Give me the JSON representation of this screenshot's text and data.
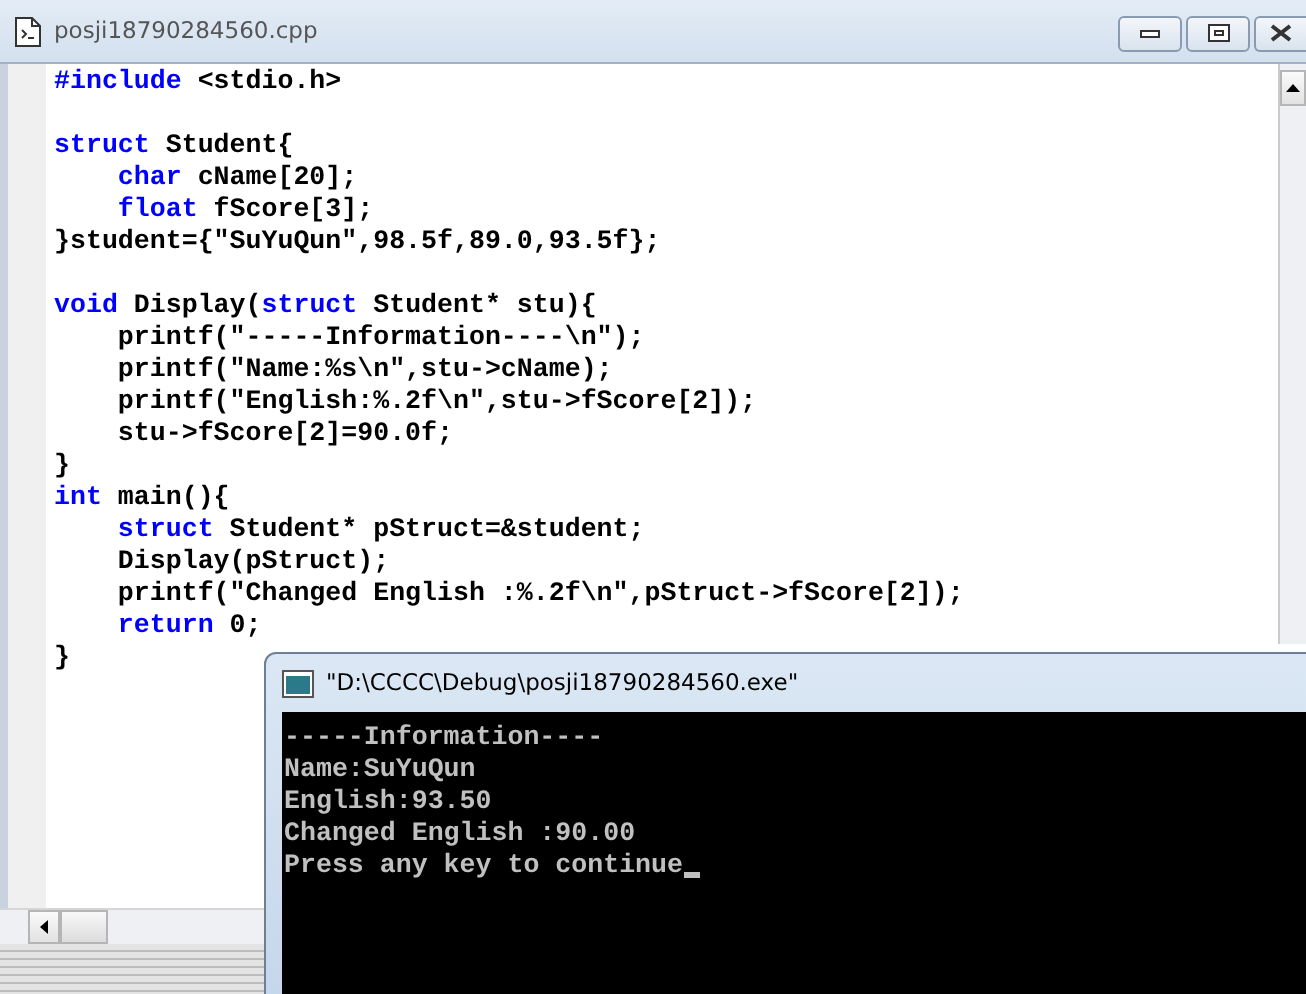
{
  "editor": {
    "title": "posji18790284560.cpp",
    "lines": [
      {
        "kind": "code",
        "tokens": [
          {
            "text": "#include",
            "kind": "keyword"
          },
          {
            "text": " <stdio.h>",
            "kind": "plain"
          }
        ]
      },
      {
        "kind": "blank"
      },
      {
        "kind": "code",
        "tokens": [
          {
            "text": "struct",
            "kind": "keyword"
          },
          {
            "text": " Student{",
            "kind": "plain"
          }
        ]
      },
      {
        "kind": "code",
        "tokens": [
          {
            "text": "    char",
            "kind": "keyword"
          },
          {
            "text": " cName[20];",
            "kind": "plain"
          }
        ]
      },
      {
        "kind": "code",
        "tokens": [
          {
            "text": "    float",
            "kind": "keyword"
          },
          {
            "text": " fScore[3];",
            "kind": "plain"
          }
        ]
      },
      {
        "kind": "code",
        "tokens": [
          {
            "text": "}student={\"SuYuQun\",98.5f,89.0,93.5f};",
            "kind": "plain"
          }
        ]
      },
      {
        "kind": "blank"
      },
      {
        "kind": "code",
        "tokens": [
          {
            "text": "void",
            "kind": "keyword"
          },
          {
            "text": " Display(",
            "kind": "plain"
          },
          {
            "text": "struct",
            "kind": "keyword"
          },
          {
            "text": " Student* stu){",
            "kind": "plain"
          }
        ]
      },
      {
        "kind": "code",
        "tokens": [
          {
            "text": "    printf(\"-----Information----\\n\");",
            "kind": "plain"
          }
        ]
      },
      {
        "kind": "code",
        "tokens": [
          {
            "text": "    printf(\"Name:%s\\n\",stu->cName);",
            "kind": "plain"
          }
        ]
      },
      {
        "kind": "code",
        "tokens": [
          {
            "text": "    printf(\"English:%.2f\\n\",stu->fScore[2]);",
            "kind": "plain"
          }
        ]
      },
      {
        "kind": "code",
        "tokens": [
          {
            "text": "    stu->fScore[2]=90.0f;",
            "kind": "plain"
          }
        ]
      },
      {
        "kind": "code",
        "tokens": [
          {
            "text": "}",
            "kind": "plain"
          }
        ]
      },
      {
        "kind": "code",
        "tokens": [
          {
            "text": "int",
            "kind": "keyword"
          },
          {
            "text": " main(){",
            "kind": "plain"
          }
        ]
      },
      {
        "kind": "code",
        "tokens": [
          {
            "text": "    struct",
            "kind": "keyword"
          },
          {
            "text": " Student* pStruct=&student;",
            "kind": "plain"
          }
        ]
      },
      {
        "kind": "code",
        "tokens": [
          {
            "text": "    Display(pStruct);",
            "kind": "plain"
          }
        ]
      },
      {
        "kind": "code",
        "tokens": [
          {
            "text": "    printf(\"Changed English :%.2f\\n\",pStruct->fScore[2]);",
            "kind": "plain"
          }
        ]
      },
      {
        "kind": "code",
        "tokens": [
          {
            "text": "    return",
            "kind": "keyword"
          },
          {
            "text": " 0;",
            "kind": "plain"
          }
        ]
      },
      {
        "kind": "code",
        "tokens": [
          {
            "text": "}",
            "kind": "plain"
          }
        ]
      }
    ]
  },
  "console": {
    "title": "\"D:\\CCCC\\Debug\\posji18790284560.exe\"",
    "lines": [
      "-----Information----",
      "Name:SuYuQun",
      "English:93.50",
      "Changed English :90.00",
      "Press any key to continue"
    ],
    "cursor": true
  }
}
